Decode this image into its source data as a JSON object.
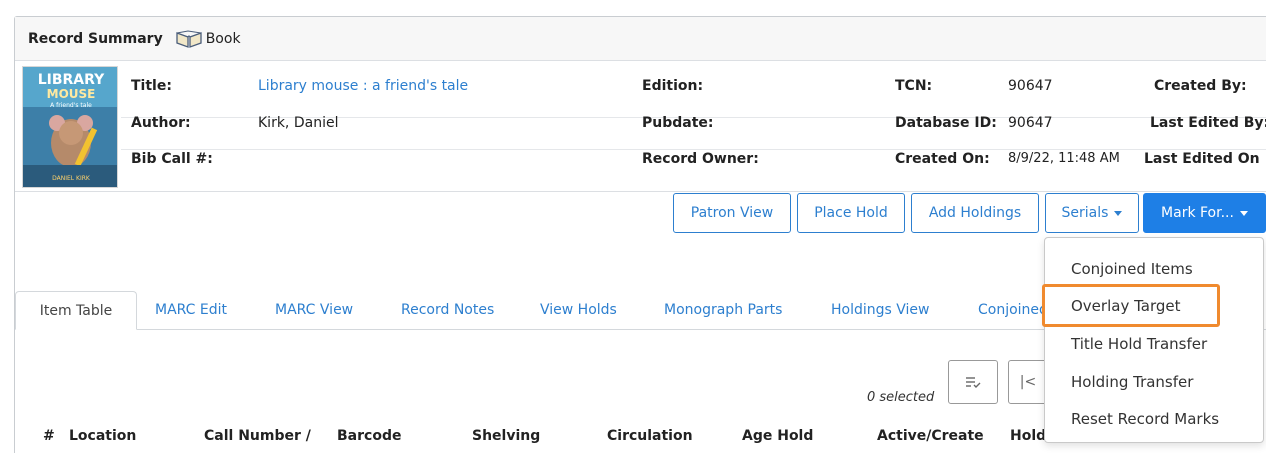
{
  "record": {
    "header_title": "Record Summary",
    "format": "Book",
    "title_label": "Title:",
    "title_value": "Library mouse : a friend's tale",
    "author_label": "Author:",
    "author_value": "Kirk, Daniel",
    "bib_call_label": "Bib Call #:",
    "edition_label": "Edition:",
    "pubdate_label": "Pubdate:",
    "record_owner_label": "Record Owner:",
    "tcn_label": "TCN:",
    "tcn_value": "90647",
    "database_id_label": "Database ID:",
    "database_id_value": "90647",
    "created_on_label": "Created On:",
    "created_on_value": "8/9/22, 11:48 AM",
    "created_by_label": "Created By:",
    "last_edited_by_label": "Last Edited By:",
    "last_edited_on_label": "Last Edited On"
  },
  "cover": {
    "line1": "LIBRARY",
    "line2": "MOUSE",
    "line3": "A friend's tale",
    "author": "DANIEL KIRK"
  },
  "actions": {
    "patron_view": "Patron View",
    "place_hold": "Place Hold",
    "add_holdings": "Add Holdings",
    "serials": "Serials",
    "mark_for": "Mark For..."
  },
  "dropdown": {
    "items": [
      "Conjoined Items",
      "Overlay Target",
      "Title Hold Transfer",
      "Holding Transfer",
      "Reset Record Marks"
    ],
    "highlighted": "Overlay Target",
    "highlight_color": "#f08a2e"
  },
  "tabs": [
    "Item Table",
    "MARC Edit",
    "MARC View",
    "Record Notes",
    "View Holds",
    "Monograph Parts",
    "Holdings View",
    "Conjoined Items"
  ],
  "grid": {
    "selected_text": "0 selected",
    "columns": [
      "#",
      "Location",
      "Call Number /",
      "Barcode",
      "Shelving",
      "Circulation",
      "Age Hold",
      "Active/Create",
      "Holds"
    ]
  },
  "colors": {
    "link": "#2d7fcf",
    "primary": "#1e7fe6"
  }
}
